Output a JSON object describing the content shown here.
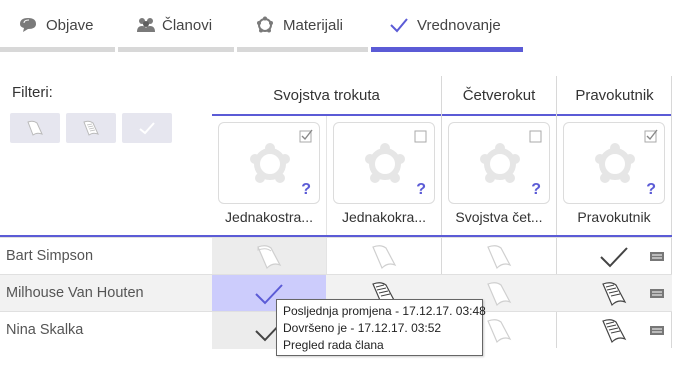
{
  "tabs": [
    {
      "label": "Objave",
      "icon": "chat-bubble-icon",
      "active": false
    },
    {
      "label": "Članovi",
      "icon": "people-icon",
      "active": false
    },
    {
      "label": "Materijali",
      "icon": "gear-icon",
      "active": false
    },
    {
      "label": "Vrednovanje",
      "icon": "checkmark-icon",
      "active": true
    }
  ],
  "filters": {
    "label": "Filteri:",
    "buttons": [
      "blank-page-icon",
      "written-page-icon",
      "checkmark-icon"
    ]
  },
  "groups": [
    {
      "title": "Svojstva trokuta"
    },
    {
      "title": "Četverokut"
    },
    {
      "title": "Pravokutnik"
    }
  ],
  "columns": [
    {
      "title": "Jednakostra...",
      "group": "Svojstva trokuta"
    },
    {
      "title": "Jednakokra...",
      "group": "Svojstva trokuta"
    },
    {
      "title": "Svojstva čet...",
      "group": "Četverokut"
    },
    {
      "title": "Pravokutnik",
      "group": "Pravokutnik"
    }
  ],
  "students": [
    {
      "name": "Bart Simpson",
      "cells": [
        "blank",
        "blank",
        "blank",
        "check"
      ]
    },
    {
      "name": "Milhouse Van Houten",
      "cells": [
        "check",
        "written",
        "blank",
        "written"
      ]
    },
    {
      "name": "Nina Skalka",
      "cells": [
        "check",
        "written",
        "blank",
        "written"
      ]
    }
  ],
  "tooltip": {
    "line1": "Posljednja promjena - 17.12.17. 03:48",
    "line2": "Dovršeno je - 17.12.17. 03:52",
    "line3": "Pregled rada člana"
  },
  "colors": {
    "accent": "#5b5bd6",
    "selected_cell": "#ccccfc",
    "tab_inactive": "#d8d8d8"
  }
}
